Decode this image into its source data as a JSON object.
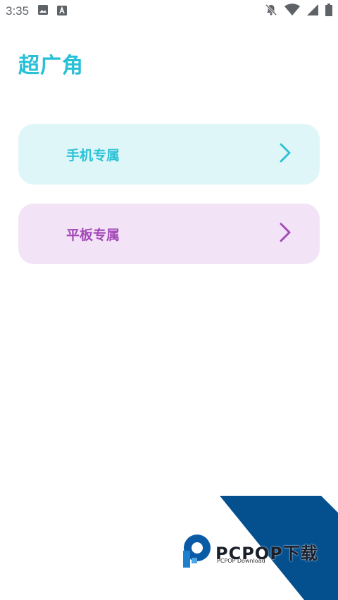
{
  "status_bar": {
    "time": "3:35",
    "icons": [
      "image-icon",
      "a-notification-icon",
      "notifications-off-icon",
      "wifi-icon",
      "signal-icon",
      "battery-icon"
    ]
  },
  "app": {
    "title": "超广角"
  },
  "menu": {
    "items": [
      {
        "label": "手机专属",
        "color": "#2cc3d6",
        "background": "#dff6f9",
        "icon": "chevron-right-icon"
      },
      {
        "label": "平板专属",
        "color": "#a44ab8",
        "background": "#f2e4f6",
        "icon": "chevron-right-icon"
      }
    ]
  },
  "watermark": {
    "brand": "PCPOP下载",
    "subtitle": "PCPOP Download",
    "accent": "#04508f"
  },
  "colors": {
    "title": "#27c0d6"
  }
}
